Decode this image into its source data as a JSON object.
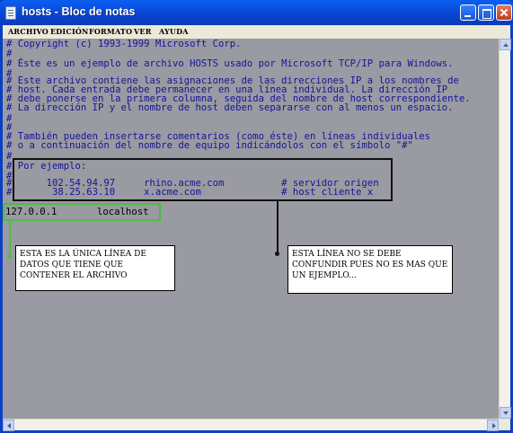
{
  "window": {
    "title": "hosts - Bloc de notas"
  },
  "menu": [
    "ARCHIVO",
    "EDICIÓN",
    "FORMATO",
    "VER",
    "AYUDA"
  ],
  "document": {
    "lines": [
      "# Copyright (c) 1993-1999 Microsoft Corp.",
      "#",
      "# Éste es un ejemplo de archivo HOSTS usado por Microsoft TCP/IP para Windows.",
      "#",
      "# Este archivo contiene las asignaciones de las direcciones IP a los nombres de",
      "# host. Cada entrada debe permanecer en una línea individual. La dirección IP",
      "# debe ponerse en la primera columna, seguida del nombre de host correspondiente.",
      "# La dirección IP y el nombre de host deben separarse con al menos un espacio.",
      "#",
      "#",
      "# También pueden insertarse comentarios (como éste) en líneas individuales",
      "# o a continuación del nombre de equipo indicándolos con el símbolo \"#\"",
      "#",
      "# Por ejemplo:",
      "#",
      "#      102.54.94.97     rhino.acme.com          # servidor origen",
      "#       38.25.63.10     x.acme.com              # host cliente x",
      "",
      "127.0.0.1       localhost"
    ]
  },
  "annotations": {
    "green_callout": "Esta es la única línea de datos que tiene que contener el archivo",
    "black_callout": "Esta línea no se debe confundir pues no es mas que un ejemplo...",
    "green_color": "#48c040",
    "black_color": "#101010"
  }
}
